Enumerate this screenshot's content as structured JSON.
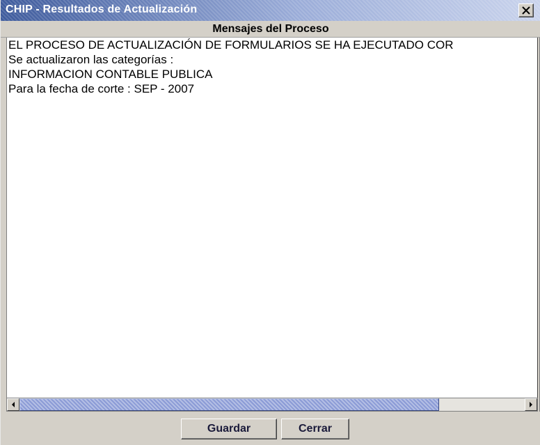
{
  "window": {
    "title": "CHIP - Resultados de Actualización"
  },
  "header": {
    "title": "Mensajes del Proceso"
  },
  "messages": [
    "EL PROCESO DE ACTUALIZACIÓN DE FORMULARIOS SE HA EJECUTADO COR",
    "Se actualizaron las categorías :",
    "INFORMACION CONTABLE PUBLICA",
    "Para la fecha de corte : SEP - 2007"
  ],
  "buttons": {
    "save_label": "Guardar",
    "close_label": "Cerrar"
  },
  "scrollbar": {
    "position_fraction": 0.0,
    "visible_fraction": 0.83
  },
  "icons": {
    "close": "close-icon",
    "scroll_left": "arrow-left-icon",
    "scroll_right": "arrow-right-icon"
  },
  "colors": {
    "title_bar": "#3d5a9c",
    "scroll_thumb": "#8b9bd6",
    "window_bg": "#d4d0c8"
  }
}
